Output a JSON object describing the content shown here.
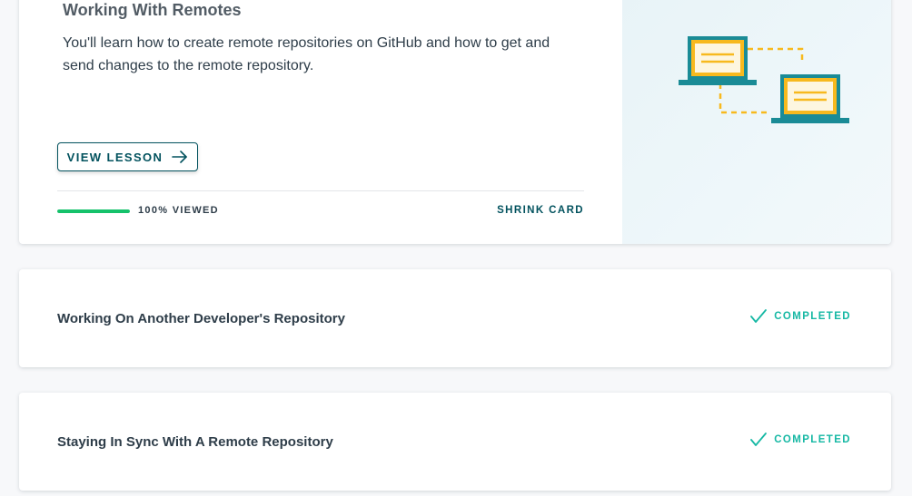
{
  "lesson_expanded": {
    "title": "Working With Remotes",
    "description": "You'll learn how to create remote repositories on GitHub and how to get and send changes to the remote repository.",
    "view_lesson_label": "VIEW LESSON",
    "progress_percent": 100,
    "progress_label": "100% VIEWED",
    "shrink_label": "SHRINK CARD",
    "illustration": "two-laptops-connected-icon"
  },
  "lessons": [
    {
      "title": "Working On Another Developer's Repository",
      "status": "COMPLETED",
      "status_icon": "checkmark-icon"
    },
    {
      "title": "Staying In Sync With A Remote Repository",
      "status": "COMPLETED",
      "status_icon": "checkmark-icon"
    }
  ],
  "colors": {
    "accent": "#02525e",
    "progress": "#15c26b",
    "completed": "#16b8a4",
    "laptop_frame": "#1a8b96",
    "laptop_screen": "#f7b91e"
  }
}
